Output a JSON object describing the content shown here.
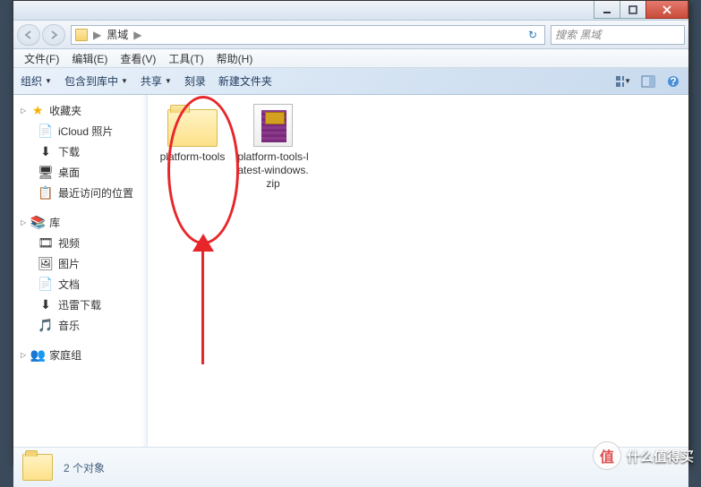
{
  "window_controls": {
    "min": "min",
    "max": "max",
    "close": "close"
  },
  "breadcrumb": {
    "folder": "黑域",
    "sep1": "▶",
    "sep2": "▶"
  },
  "nav": {
    "refresh_hint": "↻",
    "search_placeholder": "搜索 黑域"
  },
  "menu": {
    "file": "文件(F)",
    "edit": "编辑(E)",
    "view": "查看(V)",
    "tools": "工具(T)",
    "help": "帮助(H)"
  },
  "toolbar": {
    "organize": "组织",
    "include": "包含到库中",
    "share": "共享",
    "burn": "刻录",
    "newfolder": "新建文件夹",
    "dropdown": "▼"
  },
  "sidebar": {
    "favorites": {
      "label": "收藏夹",
      "items": [
        {
          "icon": "📄",
          "label": "iCloud 照片"
        },
        {
          "icon": "⬇",
          "label": "下载"
        },
        {
          "icon": "🖥",
          "label": "桌面"
        },
        {
          "icon": "📋",
          "label": "最近访问的位置"
        }
      ]
    },
    "libraries": {
      "label": "库",
      "items": [
        {
          "icon": "🎞",
          "label": "视频"
        },
        {
          "icon": "🖼",
          "label": "图片"
        },
        {
          "icon": "📄",
          "label": "文档"
        },
        {
          "icon": "⬇",
          "label": "迅雷下载"
        },
        {
          "icon": "🎵",
          "label": "音乐"
        }
      ]
    },
    "homegroup": {
      "label": "家庭组"
    }
  },
  "files": [
    {
      "name": "platform-tools",
      "type": "folder"
    },
    {
      "name": "platform-tools-latest-windows.zip",
      "type": "zip"
    }
  ],
  "status": {
    "text": "2 个对象"
  },
  "watermark": {
    "symbol": "值",
    "text": "什么值得买"
  }
}
